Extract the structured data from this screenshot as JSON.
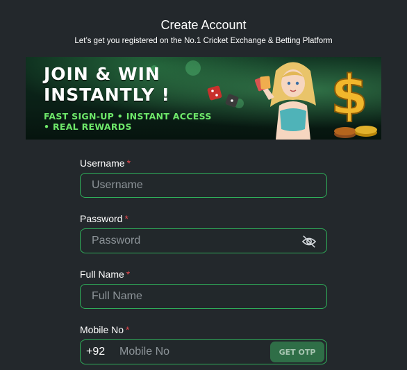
{
  "header": {
    "title": "Create Account",
    "subtitle": "Let’s get you registered on the No.1 Cricket Exchange & Betting Platform"
  },
  "banner": {
    "headline_line1": "JOIN & WIN",
    "headline_line2": "INSTANTLY !",
    "tagline_line1": "FAST SIGN-UP • INSTANT ACCESS",
    "tagline_line2": "• REAL REWARDS"
  },
  "form": {
    "username": {
      "label": "Username",
      "required_mark": "*",
      "placeholder": "Username",
      "value": ""
    },
    "password": {
      "label": "Password",
      "required_mark": "*",
      "placeholder": "Password",
      "value": "",
      "toggle_icon": "eye-off-icon"
    },
    "full_name": {
      "label": "Full Name",
      "required_mark": "*",
      "placeholder": "Full Name",
      "value": ""
    },
    "mobile": {
      "label": "Mobile No",
      "required_mark": "*",
      "prefix": "+92",
      "placeholder": "Mobile No",
      "value": "",
      "otp_button": "GET OTP"
    }
  },
  "colors": {
    "background": "#23282c",
    "accent_border": "#2fae5a",
    "required": "#e5484d",
    "otp_button": "#2f6e47",
    "tagline": "#6ee86a"
  }
}
